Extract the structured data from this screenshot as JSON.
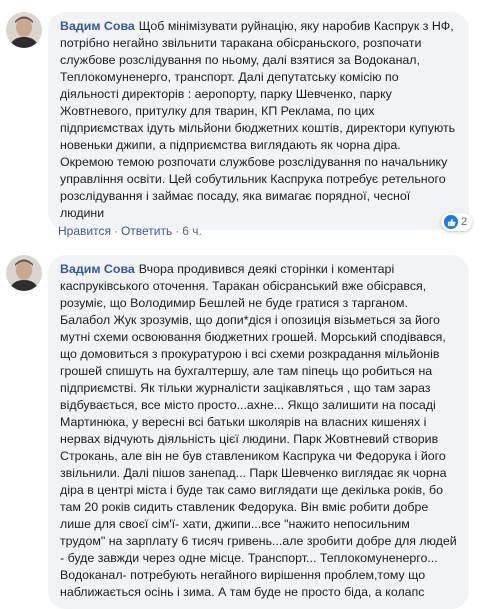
{
  "comments": [
    {
      "author": "Вадим Сова",
      "text": "Щоб мінімізувати руйнацію, яку наробив Каспрук з НФ, потрібно негайно звільнити таракана обісраньского, розпочати службове розслідування по ньому, далі взятися за Водоканал, Теплокомуненерго, транспорт. Далі депутатську комісію по діяльності директорів : аеропорту, парку Шевченко, парку Жовтневого, притулку для тварин, КП Реклама, по цих підприємствах ідуть мільйони бюджетних коштів, директори купують новеньки джипи, а підприємства виглядають як чорна діра. Окремою темою розпочати службове розслідування по начальнику управління освіти. Цей собутильник Каспрука потребує ретельного розслідування і займає посаду, яка вимагає порядної, чесної людини",
      "like_label": "Нравится",
      "reply_label": "Ответить",
      "time": "6 ч.",
      "reaction_count": "2"
    },
    {
      "author": "Вадим Сова",
      "text": "Вчора продивився деякі сторінки і коментарі каспруківського оточення. Таракан обісранський вже обісрався, розуміє, що Володимир Бешлей не буде гратися з тарганом. Балабол Жук зрозумів, що допи*діся і опозиція візьметься за його мутні схеми освоювання бюджетних грошей. Морський сподівався, що домовиться з прокуратурою і всі схеми розкрадання мільйонів грошей спишуть на бухгалтершу, але там піпець що робиться на підприємстві. Як тільки журналісти зацікавляться , що там зараз відбувається, все місто просто...ахне... Якщо залишити на посаді Мартинюка, у вересні всі батьки школярів на власних кишенях і нервах відчують діяльність цієї людини. Парк Жовтневий створив Строкань, але він не був ставлеником Каспрука чи Федорука і його звільнили. Далі пішов занепад... Парк Шевченко виглядає як чорна діра в центрі міста і буде так само виглядати ще декілька років, бо там 20 років сидить ставленик Федорука. Він вміє робити добре лише для своєї сім'ї- хати, джипи...все \"нажито непосильним трудом\" на зарплату 6 тисяч гривень...але зробити добре для людей - буде завжди через одне місце. Транспорт... Теплокомуненерго... Водоканал- потребують негайного вирішення проблем,тому що наближається осінь і зима. А там буде не просто біда, а колапс"
    }
  ],
  "icons": {
    "avatar": "avatar-photo",
    "reaction": "thumbs-up-icon"
  },
  "colors": {
    "author": "#385898",
    "bubble": "#f2f3f5",
    "like": "#1877f2"
  }
}
